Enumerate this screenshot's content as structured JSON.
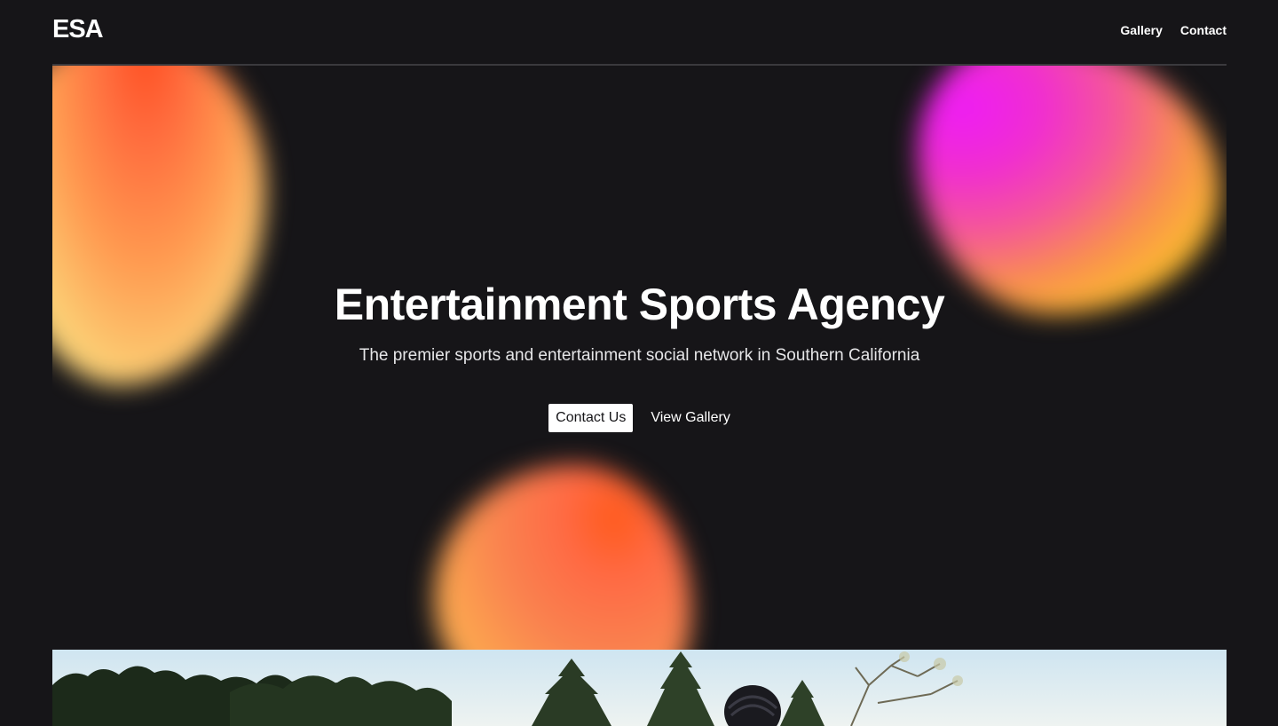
{
  "header": {
    "logo": "ESA",
    "nav": [
      {
        "label": "Gallery"
      },
      {
        "label": "Contact"
      }
    ]
  },
  "hero": {
    "title": "Entertainment Sports Agency",
    "subtitle": "The premier sports and entertainment social network in Southern California",
    "primary_button": "Contact Us",
    "secondary_button": "View Gallery"
  },
  "colors": {
    "background": "#161518",
    "text": "#ffffff",
    "button_bg": "#ffffff",
    "button_text": "#161518"
  }
}
